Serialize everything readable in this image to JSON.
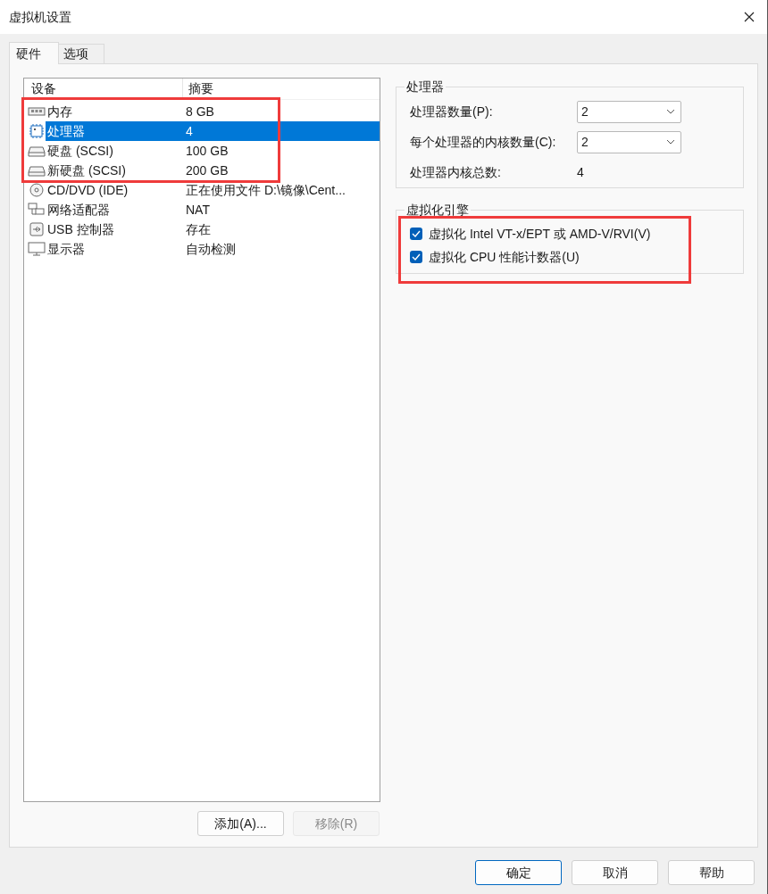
{
  "window": {
    "title": "虚拟机设置"
  },
  "tabs": [
    {
      "label": "硬件",
      "selected": true
    },
    {
      "label": "选项",
      "selected": false
    }
  ],
  "device_list": {
    "columns": [
      "设备",
      "摘要"
    ],
    "rows": [
      {
        "kind": "memory",
        "device": "内存",
        "summary": "8 GB",
        "selected": false,
        "highlighted": true
      },
      {
        "kind": "cpu",
        "device": "处理器",
        "summary": "4",
        "selected": true,
        "highlighted": true
      },
      {
        "kind": "disk",
        "device": "硬盘 (SCSI)",
        "summary": "100 GB",
        "selected": false,
        "highlighted": true
      },
      {
        "kind": "disk",
        "device": "新硬盘 (SCSI)",
        "summary": "200 GB",
        "selected": false,
        "highlighted": true
      },
      {
        "kind": "cd",
        "device": "CD/DVD (IDE)",
        "summary": "正在使用文件 D:\\镜像\\Cent...",
        "selected": false,
        "highlighted": false
      },
      {
        "kind": "network",
        "device": "网络适配器",
        "summary": "NAT",
        "selected": false,
        "highlighted": false
      },
      {
        "kind": "usb",
        "device": "USB 控制器",
        "summary": "存在",
        "selected": false,
        "highlighted": false
      },
      {
        "kind": "display",
        "device": "显示器",
        "summary": "自动检测",
        "selected": false,
        "highlighted": false
      }
    ]
  },
  "list_buttons": [
    {
      "label": "添加(A)...",
      "disabled": false
    },
    {
      "label": "移除(R)",
      "disabled": true
    }
  ],
  "processor_group": {
    "title": "处理器",
    "fields": [
      {
        "kind": "select",
        "label": "处理器数量(P):",
        "value": "2"
      },
      {
        "kind": "select",
        "label": "每个处理器的内核数量(C):",
        "value": "2"
      },
      {
        "kind": "readout",
        "label": "处理器内核总数:",
        "value": "4"
      }
    ]
  },
  "virtualization_group": {
    "title": "虚拟化引擎",
    "highlighted": true,
    "options": [
      {
        "label": "虚拟化 Intel VT-x/EPT 或 AMD-V/RVI(V)",
        "checked": true
      },
      {
        "label": "虚拟化 CPU 性能计数器(U)",
        "checked": true
      }
    ]
  },
  "dialog_buttons": [
    {
      "label": "确定",
      "default": true
    },
    {
      "label": "取消",
      "default": false
    },
    {
      "label": "帮助",
      "default": false
    }
  ]
}
